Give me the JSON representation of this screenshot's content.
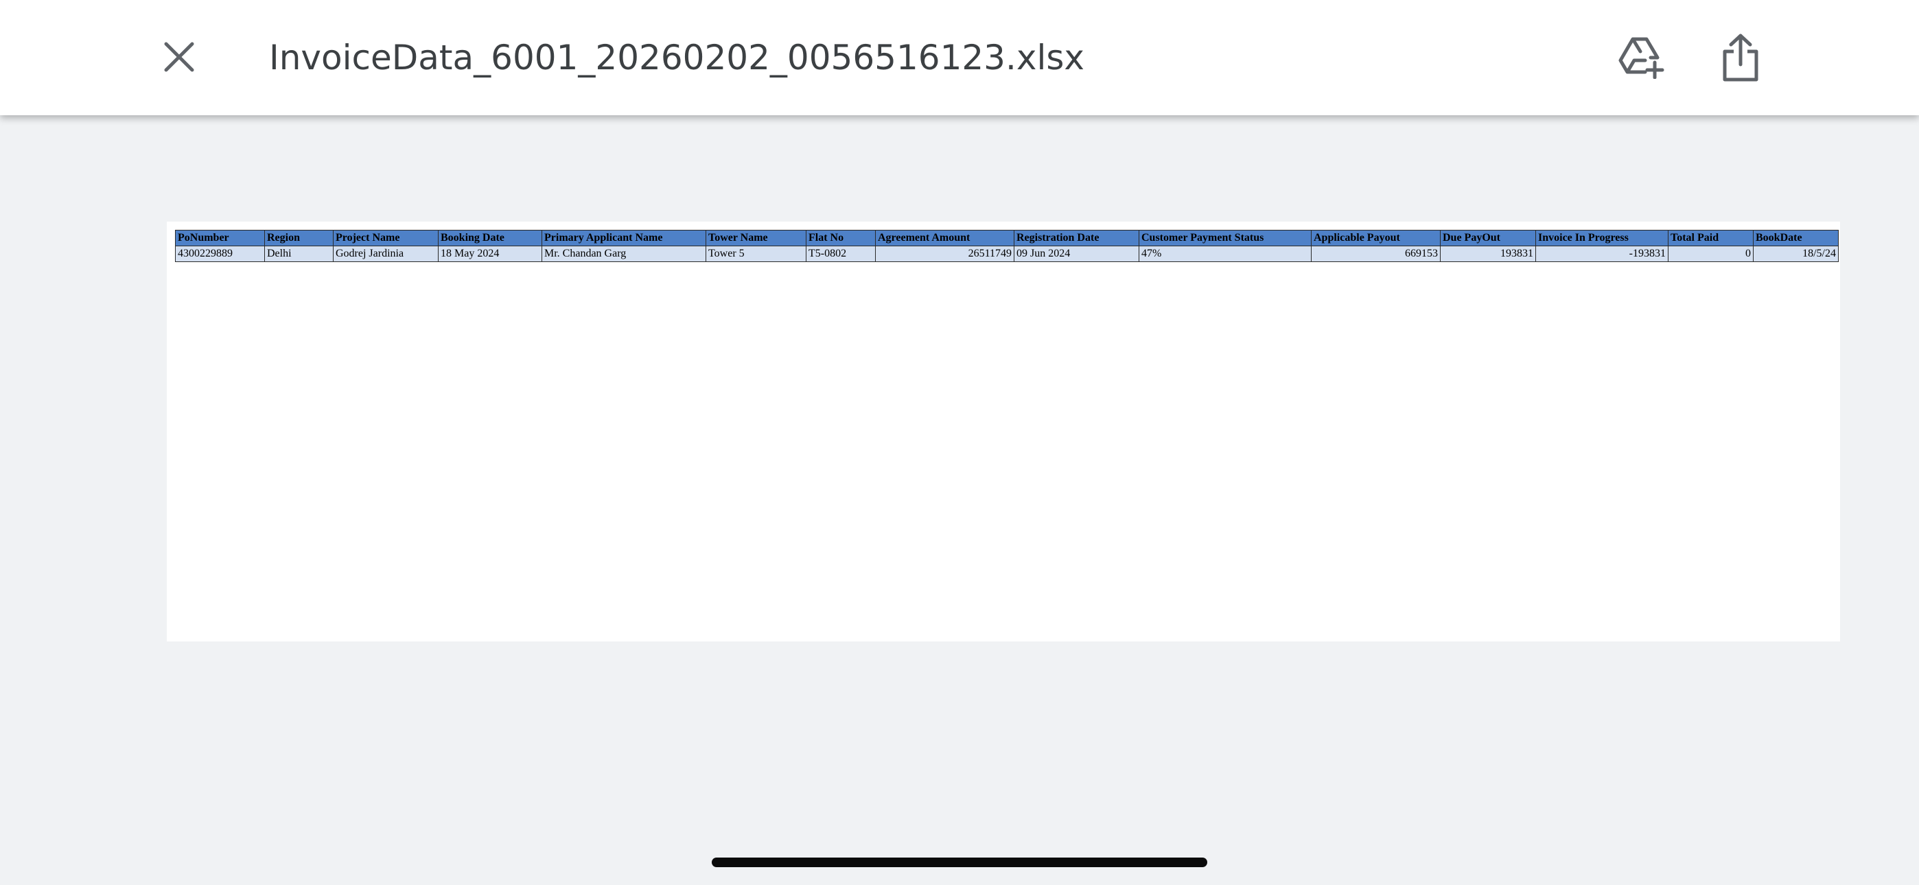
{
  "header": {
    "file_name": "InvoiceData_6001_20260202_0056516123.xlsx",
    "close_icon": "close-icon",
    "drive_icon": "add-to-drive-icon",
    "share_icon": "share-icon"
  },
  "spreadsheet": {
    "columns": [
      "PoNumber",
      "Region",
      "Project Name",
      "Booking Date",
      "Primary Applicant Name",
      "Tower Name",
      "Flat No",
      "Agreement Amount",
      "Registration Date",
      "Customer Payment Status",
      "Applicable Payout",
      "Due PayOut",
      "Invoice In Progress",
      "Total Paid",
      "BookDate"
    ],
    "rows": [
      [
        "4300229889",
        "Delhi",
        "Godrej Jardinia",
        "18 May 2024",
        "Mr. Chandan Garg",
        "Tower 5",
        "T5-0802",
        "26511749",
        "09 Jun 2024",
        "47%",
        "669153",
        "193831",
        "-193831",
        "0",
        "18/5/24"
      ]
    ]
  },
  "colors": {
    "header_fill": "#4e81c8",
    "row_fill": "#d4e0f1",
    "page_background": "#f0f2f4"
  }
}
